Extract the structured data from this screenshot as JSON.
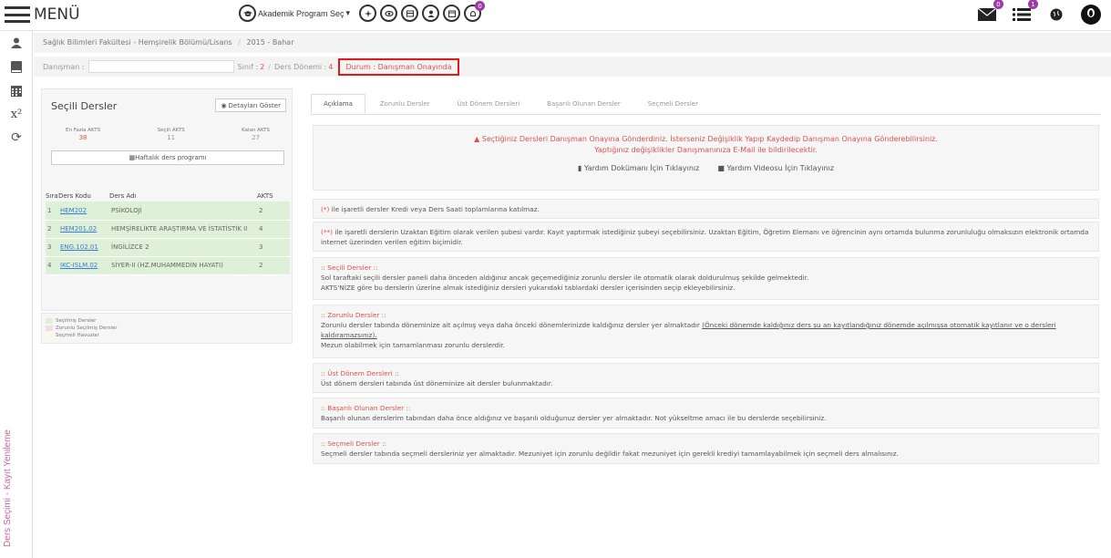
{
  "topbar": {
    "menu_label": "MENÜ",
    "program_select": "Akademik Program Seç",
    "notif_badges": [
      "0",
      "0",
      "1"
    ]
  },
  "sidebar": {
    "vertical_label": "Ders Seçimi - Kayıt Yenileme"
  },
  "breadcrumb": {
    "faculty": "Sağlık Bilimleri Fakültesi - Hemşirelik Bölümü/Lisans",
    "term": "2015 - Bahar"
  },
  "infobar": {
    "advisor_label": "Danışman :",
    "class_label": "Sınıf :",
    "class_value": "2",
    "term_label": "Ders Dönemi :",
    "term_value": "4",
    "status": "Durum : Danışman Onayında"
  },
  "left_panel": {
    "title": "Seçili Dersler",
    "detail_button": "Detayları Göster",
    "stats": [
      {
        "label": "En Fazla AKTS",
        "value": "38"
      },
      {
        "label": "Seçili AKTS",
        "value": "11"
      },
      {
        "label": "Kalan AKTS",
        "value": "27"
      }
    ],
    "weekly_button": "Haftalık ders programı",
    "table_headers": [
      "Sıra",
      "Ders Kodu",
      "Ders Adı",
      "AKTS"
    ],
    "courses": [
      {
        "no": "1",
        "code": "HEM202",
        "name": "PSİKOLOJİ",
        "akts": "2"
      },
      {
        "no": "2",
        "code": "HEM201.02",
        "name": "HEMŞİRELİKTE ARAŞTIRMA VE İSTATİSTİK II",
        "akts": "4"
      },
      {
        "no": "3",
        "code": "ENG.102.01",
        "name": "İNGİLİZCE 2",
        "akts": "3"
      },
      {
        "no": "4",
        "code": "IKC-ISLM.02",
        "name": "SİYER-II (HZ.MUHAMMEDİN HAYATI)",
        "akts": "2"
      }
    ],
    "legend": [
      "Seçilmiş Dersler",
      "Zorunlu Seçilmiş Dersler",
      "Seçmeli Havuzlar"
    ]
  },
  "tabs": [
    "Açıklama",
    "Zorunlu Dersler",
    "Üst Dönem Dersleri",
    "Başarılı Olunan Dersler",
    "Seçmeli Dersler"
  ],
  "notice": {
    "line1": "Seçtiğiniz Dersleri Danışman Onayına Gönderdiniz. İsterseniz Değişiklik Yapıp Kaydedip Danışman Onayına Gönderebilirsiniz.",
    "line2": "Yaptığınız değişiklikler Danışmanınıza E-Mail ile bildirilecektir.",
    "help_doc": "Yardım Dokümanı İçin Tıklayınız",
    "help_video": "Yardım Videosu İçin Tıklayınız"
  },
  "notes": {
    "star1_prefix": "(*)",
    "star1": " ile işaretli dersler Kredi veya Ders Saati toplamlarına katılmaz.",
    "star2_prefix": "(**)",
    "star2": " ile işaretli derslerin Uzaktan Eğitim olarak verilen şubesi vardır. Kayıt yaptırmak istediğiniz şubeyi seçebilirsiniz. Uzaktan Eğitim, Öğretim Elemanı ve öğrencinin aynı ortamda bulunma zorunluluğu olmaksızın elektronik ortamda internet üzerinden verilen eğitim biçimidir.",
    "secili_title": ":: Seçili Dersler ::",
    "secili_1": "Sol taraftaki seçili dersler paneli daha önceden aldığınız ancak geçemediğiniz zorunlu dersler ile otomatik olarak doldurulmuş şekilde gelmektedir.",
    "secili_2": "AKTS'NİZE göre bu derslerin üzerine almak istediğiniz dersleri yukarıdaki tablardaki dersler içerisinden seçip ekleyebilirsiniz.",
    "zorunlu_title": ":: Zorunlu Dersler ::",
    "zorunlu_1": "Zorunlu dersler tabında döneminize ait açılmış veya daha önceki dönemlerinizde kaldığınız dersler yer almaktadır ",
    "zorunlu_1u": "(Önceki dönemde kaldığınız ders şu an kayıtlandığınız dönemde açılmışsa otomatik kayıtlanır ve o dersleri kaldıramazsınız).",
    "zorunlu_2": "Mezun olabilmek için tamamlanması zorunlu derslerdir.",
    "ust_title": ":: Üst Dönem Dersleri ::",
    "ust_1": "Üst dönem dersleri tabında üst döneminize ait dersler bulunmaktadır.",
    "basarili_title": ":: Başarılı Olunan Dersler ::",
    "basarili_1": "Başarılı olunan derslerim tabından daha önce aldığınız ve başarılı olduğunuz dersler yer almaktadır. Not yükseltme amacı ile bu derslerde seçebilirsiniz.",
    "secmeli_title": ":: Seçmeli Dersler ::",
    "secmeli_1": "Seçmeli dersler tabında seçmeli dersleriniz yer almaktadır. Mezuniyet için zorunlu değildir fakat mezuniyet için gerekli krediyi tamamlayabilmek için seçmeli ders almalısınız."
  }
}
